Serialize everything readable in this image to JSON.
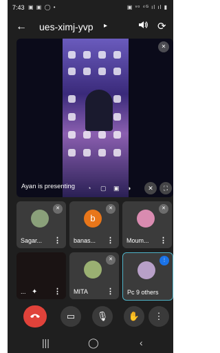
{
  "status": {
    "time": "7:43",
    "left_icons": "▣ ▣ ◯ •",
    "right_icons": "▣ ᵛᵒ ⁴ᴳ ıl ıl ▮"
  },
  "header": {
    "meeting_code": "ues-ximj-yvp",
    "back_icon": "arrow-left",
    "chevron": "▸",
    "volume_icon": "🔊",
    "flip_icon": "⟳"
  },
  "presentation": {
    "label": "Ayan is presenting",
    "mute_glyph": "✕"
  },
  "tiles": [
    {
      "name": "Sagar...",
      "avatar_letter": "",
      "avatar_color": "#8aa07a",
      "muted": true
    },
    {
      "name": "banas...",
      "avatar_letter": "b",
      "avatar_color": "#e8761a",
      "muted": true
    },
    {
      "name": "Moum...",
      "avatar_letter": "",
      "avatar_color": "#d98bb0",
      "muted": true
    },
    {
      "name": "...",
      "avatar_letter": "",
      "avatar_color": "#2a1a1a",
      "muted": false
    },
    {
      "name": "MITA",
      "avatar_letter": "",
      "avatar_color": "#9ab072",
      "muted": true
    },
    {
      "name": "9 others",
      "avatar_letter": "",
      "avatar_color": "#b8a0c8",
      "muted": false,
      "prefix": "Pc"
    }
  ],
  "controls": {
    "end_call": "end-call",
    "camera": "camera",
    "mic": "mic",
    "raise_hand": "raise-hand",
    "more": "more"
  },
  "colors": {
    "end_call": "#e0423a",
    "active_border": "#4fb3c8"
  }
}
